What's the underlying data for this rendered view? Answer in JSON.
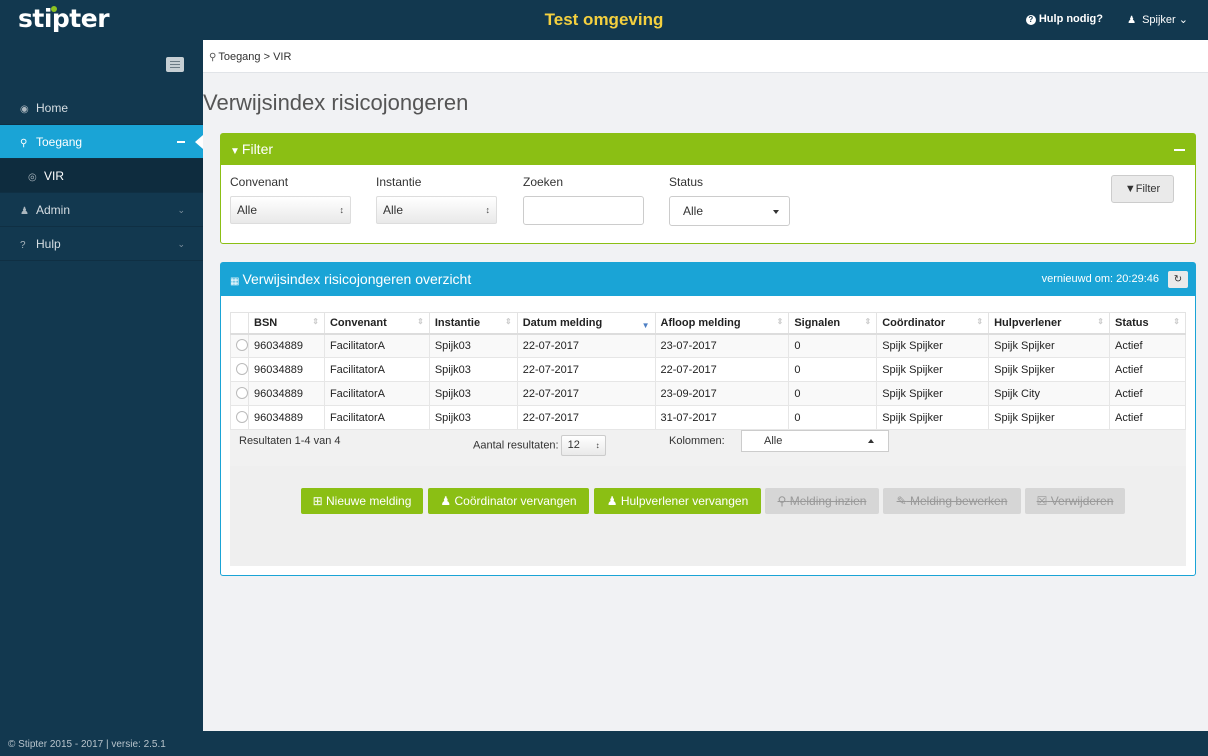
{
  "header": {
    "logo": "stipter",
    "environment": "Test omgeving",
    "help": "Hulp nodig?",
    "user": "Spijker"
  },
  "sidebar": {
    "items": [
      {
        "label": "Home"
      },
      {
        "label": "Toegang"
      },
      {
        "label": "VIR"
      },
      {
        "label": "Admin"
      },
      {
        "label": "Hulp"
      }
    ],
    "footer": "© Stipter 2015 - 2017 | versie: 2.5.1"
  },
  "breadcrumb": "Toegang > VIR",
  "page_title": "Verwijsindex risicojongeren",
  "filter": {
    "title": "Filter",
    "convenant_label": "Convenant",
    "convenant_value": "Alle",
    "instantie_label": "Instantie",
    "instantie_value": "Alle",
    "zoeken_label": "Zoeken",
    "zoeken_value": "",
    "status_label": "Status",
    "status_value": "Alle",
    "button": "Filter"
  },
  "overview": {
    "title": "Verwijsindex risicojongeren overzicht",
    "refreshed": "vernieuwd om: 20:29:46",
    "columns": [
      "BSN",
      "Convenant",
      "Instantie",
      "Datum melding",
      "Afloop melding",
      "Signalen",
      "Coördinator",
      "Hulpverlener",
      "Status"
    ],
    "rows": [
      [
        "96034889",
        "FacilitatorA",
        "Spijk03",
        "22-07-2017",
        "23-07-2017",
        "0",
        "Spijk Spijker",
        "Spijk Spijker",
        "Actief"
      ],
      [
        "96034889",
        "FacilitatorA",
        "Spijk03",
        "22-07-2017",
        "22-07-2017",
        "0",
        "Spijk Spijker",
        "Spijk Spijker",
        "Actief"
      ],
      [
        "96034889",
        "FacilitatorA",
        "Spijk03",
        "22-07-2017",
        "23-09-2017",
        "0",
        "Spijk Spijker",
        "Spijk City",
        "Actief"
      ],
      [
        "96034889",
        "FacilitatorA",
        "Spijk03",
        "22-07-2017",
        "31-07-2017",
        "0",
        "Spijk Spijker",
        "Spijk Spijker",
        "Actief"
      ]
    ],
    "results_info": "Resultaten 1-4 van 4",
    "aantal_label": "Aantal resultaten:",
    "aantal_value": "12",
    "kolommen_label": "Kolommen:",
    "kolommen_value": "Alle"
  },
  "actions": {
    "nieuwe_melding": "Nieuwe melding",
    "coordinator_vervangen": "Coördinator vervangen",
    "hulpverlener_vervangen": "Hulpverlener vervangen",
    "melding_inzien": "Melding inzien",
    "melding_bewerken": "Melding bewerken",
    "verwijderen": "Verwijderen"
  },
  "colors": {
    "navy": "#12384f",
    "blue": "#1aa4d6",
    "green": "#8bbf14",
    "env_yellow": "#f4d03f"
  }
}
